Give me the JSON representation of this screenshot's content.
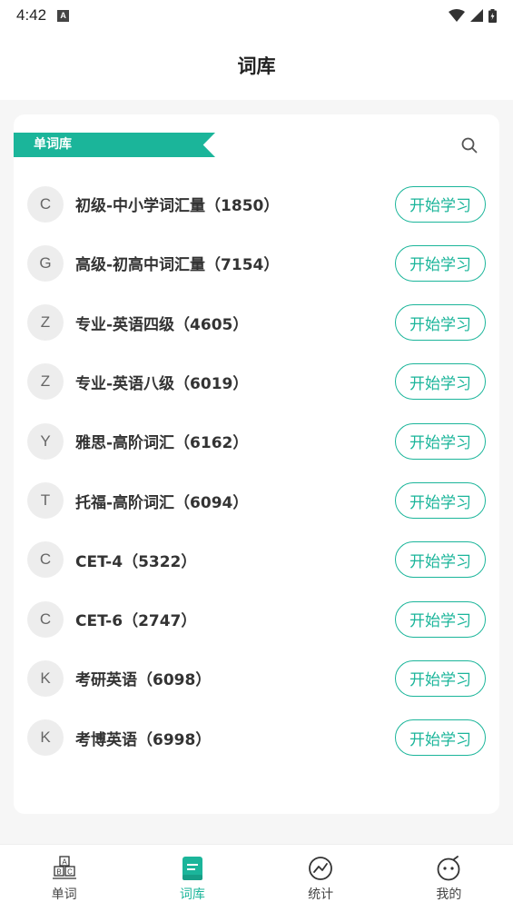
{
  "status": {
    "time": "4:42",
    "notif_badge": "A"
  },
  "header": {
    "title": "词库"
  },
  "section": {
    "label": "单词库"
  },
  "colors": {
    "accent": "#1bb59a",
    "avatar_bg": "#ededed"
  },
  "word_banks": [
    {
      "initial": "C",
      "title": "初级-中小学词汇量（1850）",
      "action": "开始学习"
    },
    {
      "initial": "G",
      "title": "高级-初高中词汇量（7154）",
      "action": "开始学习"
    },
    {
      "initial": "Z",
      "title": "专业-英语四级（4605）",
      "action": "开始学习"
    },
    {
      "initial": "Z",
      "title": "专业-英语八级（6019）",
      "action": "开始学习"
    },
    {
      "initial": "Y",
      "title": "雅思-高阶词汇（6162）",
      "action": "开始学习"
    },
    {
      "initial": "T",
      "title": "托福-高阶词汇（6094）",
      "action": "开始学习"
    },
    {
      "initial": "C",
      "title": "CET-4（5322）",
      "action": "开始学习"
    },
    {
      "initial": "C",
      "title": "CET-6（2747）",
      "action": "开始学习"
    },
    {
      "initial": "K",
      "title": "考研英语（6098）",
      "action": "开始学习"
    },
    {
      "initial": "K",
      "title": "考博英语（6998）",
      "action": "开始学习"
    }
  ],
  "tabs": [
    {
      "label": "单词",
      "icon": "abc-blocks-icon",
      "active": false
    },
    {
      "label": "词库",
      "icon": "book-icon",
      "active": true
    },
    {
      "label": "统计",
      "icon": "chart-icon",
      "active": false
    },
    {
      "label": "我的",
      "icon": "face-icon",
      "active": false
    }
  ]
}
